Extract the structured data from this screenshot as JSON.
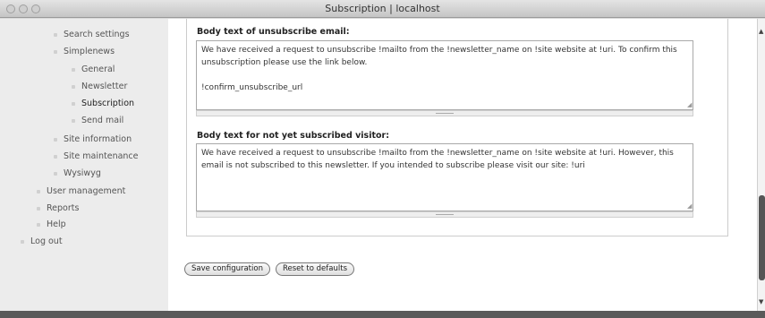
{
  "window": {
    "title": "Subscription | localhost"
  },
  "sidebar": {
    "items": [
      {
        "label": "Search settings"
      },
      {
        "label": "Simplenews"
      },
      {
        "label": "General"
      },
      {
        "label": "Newsletter"
      },
      {
        "label": "Subscription"
      },
      {
        "label": "Send mail"
      },
      {
        "label": "Site information"
      },
      {
        "label": "Site maintenance"
      },
      {
        "label": "Wysiwyg"
      },
      {
        "label": "User management"
      },
      {
        "label": "Reports"
      },
      {
        "label": "Help"
      },
      {
        "label": "Log out"
      }
    ]
  },
  "form": {
    "unsubscribe_label": "Body text of unsubscribe email:",
    "unsubscribe_body": "We have received a request to unsubscribe !mailto from the !newsletter_name on !site website at !uri. To confirm this unsubscription please use the link below.\n\n!confirm_unsubscribe_url",
    "not_subscribed_label": "Body text for not yet subscribed visitor:",
    "not_subscribed_body": "We have received a request to unsubscribe !mailto from the !newsletter_name on !site website at !uri. However, this email is not subscribed to this newsletter. If you intended to subscribe please visit our site: !uri"
  },
  "buttons": {
    "save": "Save configuration",
    "reset": "Reset to defaults"
  }
}
